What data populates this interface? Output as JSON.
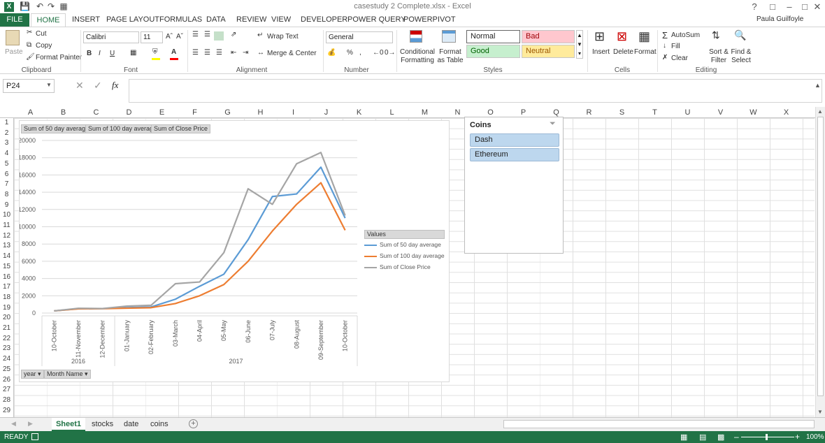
{
  "window": {
    "title": "casestudy 2 Complete.xlsx - Excel",
    "user": "Paula Guilfoyle"
  },
  "tabs": [
    "FILE",
    "HOME",
    "INSERT",
    "PAGE LAYOUT",
    "FORMULAS",
    "DATA",
    "REVIEW",
    "VIEW",
    "DEVELOPER",
    "POWER QUERY",
    "POWERPIVOT"
  ],
  "ribbon": {
    "clipboard": {
      "paste": "Paste",
      "cut": "Cut",
      "copy": "Copy",
      "format_painter": "Format Painter",
      "label": "Clipboard"
    },
    "font": {
      "name": "Calibri",
      "size": "11",
      "label": "Font"
    },
    "alignment": {
      "wrap": "Wrap Text",
      "merge": "Merge & Center",
      "label": "Alignment"
    },
    "number": {
      "format": "General",
      "label": "Number"
    },
    "styles": {
      "cond": "Conditional Formatting",
      "table": "Format as Table",
      "normal": "Normal",
      "bad": "Bad",
      "good": "Good",
      "neutral": "Neutral",
      "label": "Styles"
    },
    "cells": {
      "insert": "Insert",
      "delete": "Delete",
      "format": "Format",
      "label": "Cells"
    },
    "editing": {
      "autosum": "AutoSum",
      "fill": "Fill",
      "clear": "Clear",
      "sort": "Sort & Filter",
      "find": "Find & Select",
      "label": "Editing"
    }
  },
  "formula_bar": {
    "name_box": "P24",
    "formula": ""
  },
  "columns": [
    "A",
    "B",
    "C",
    "D",
    "E",
    "F",
    "G",
    "H",
    "I",
    "J",
    "K",
    "L",
    "M",
    "N",
    "O",
    "P",
    "Q",
    "R",
    "S",
    "T",
    "U",
    "V",
    "W",
    "X"
  ],
  "rows": [
    "1",
    "2",
    "3",
    "4",
    "5",
    "6",
    "7",
    "8",
    "9",
    "10",
    "11",
    "12",
    "13",
    "14",
    "15",
    "16",
    "17",
    "18",
    "19",
    "20",
    "21",
    "22",
    "23",
    "24",
    "25",
    "26",
    "27",
    "28",
    "29"
  ],
  "chart_data": {
    "type": "line",
    "categories": [
      "10-October",
      "11-November",
      "12-December",
      "01-January",
      "02-February",
      "03-March",
      "04-April",
      "05-May",
      "06-June",
      "07-July",
      "08-August",
      "09-September",
      "10-October"
    ],
    "year_groups": [
      {
        "label": "2016",
        "from": 0,
        "to": 2
      },
      {
        "label": "2017",
        "from": 3,
        "to": 12
      }
    ],
    "series": [
      {
        "name": "Sum of 50 day average",
        "color": "#5b9bd5",
        "values": [
          250,
          500,
          520,
          620,
          700,
          1600,
          3100,
          4500,
          8500,
          13500,
          13800,
          16900,
          11000
        ]
      },
      {
        "name": "Sum of 100 day average",
        "color": "#ed7d31",
        "values": [
          250,
          480,
          500,
          560,
          620,
          1100,
          2000,
          3300,
          6000,
          9500,
          12600,
          15100,
          9600
        ]
      },
      {
        "name": "Sum of Close Price",
        "color": "#a5a5a5",
        "values": [
          250,
          550,
          520,
          800,
          900,
          3400,
          3600,
          7000,
          14400,
          12600,
          17300,
          18600,
          11300
        ]
      }
    ],
    "ylim": [
      0,
      20000
    ],
    "yticks": [
      "20000",
      "18000",
      "16000",
      "14000",
      "12000",
      "10000",
      "8000",
      "6000",
      "4000",
      "2000",
      "0"
    ],
    "legend_title": "Values",
    "legend_position": "right",
    "field_buttons": [
      "Sum of 50 day average",
      "Sum of 100 day average",
      "Sum of Close Price"
    ],
    "axis_buttons": [
      "year",
      "Month Name"
    ],
    "grid": true
  },
  "slicer": {
    "title": "Coins",
    "items": [
      "Dash",
      "Ethereum"
    ]
  },
  "sheets": [
    "Sheet1",
    "stocks",
    "date",
    "coins"
  ],
  "status": {
    "ready": "READY",
    "zoom": "100%"
  }
}
